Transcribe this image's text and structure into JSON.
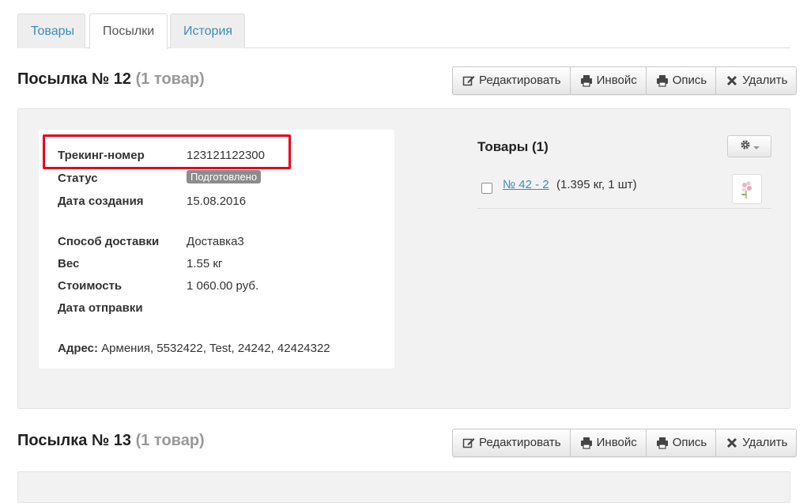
{
  "tabs": [
    {
      "label": "Товары"
    },
    {
      "label": "Посылки"
    },
    {
      "label": "История"
    }
  ],
  "actions": {
    "edit": "Редактировать",
    "invoice": "Инвойс",
    "inventory": "Опись",
    "delete": "Удалить"
  },
  "parcels": [
    {
      "title": "Посылка № 12",
      "count": "(1 товар)",
      "details": {
        "tracking_label": "Трекинг-номер",
        "tracking_value": "123121122300",
        "status_label": "Статус",
        "status_value": "Подготовлено",
        "created_label": "Дата создания",
        "created_value": "15.08.2016",
        "delivery_label": "Способ доставки",
        "delivery_value": "Доставка3",
        "weight_label": "Вес",
        "weight_value": "1.55 кг",
        "cost_label": "Стоимость",
        "cost_value": "1 060.00 руб.",
        "ship_date_label": "Дата отправки",
        "address_label": "Адрес:",
        "address_value": "Армения, 5532422, Test, 24242, 42424322"
      },
      "goods": {
        "title": "Товары (1)",
        "items": [
          {
            "link": "№ 42 - 2",
            "meta": "(1.395 кг, 1 шт)"
          }
        ]
      }
    },
    {
      "title": "Посылка № 13",
      "count": "(1 товар)"
    }
  ],
  "colors": {
    "link": "#3c8dbc",
    "highlight": "#e8001c",
    "badge": "#8c8c8c"
  }
}
